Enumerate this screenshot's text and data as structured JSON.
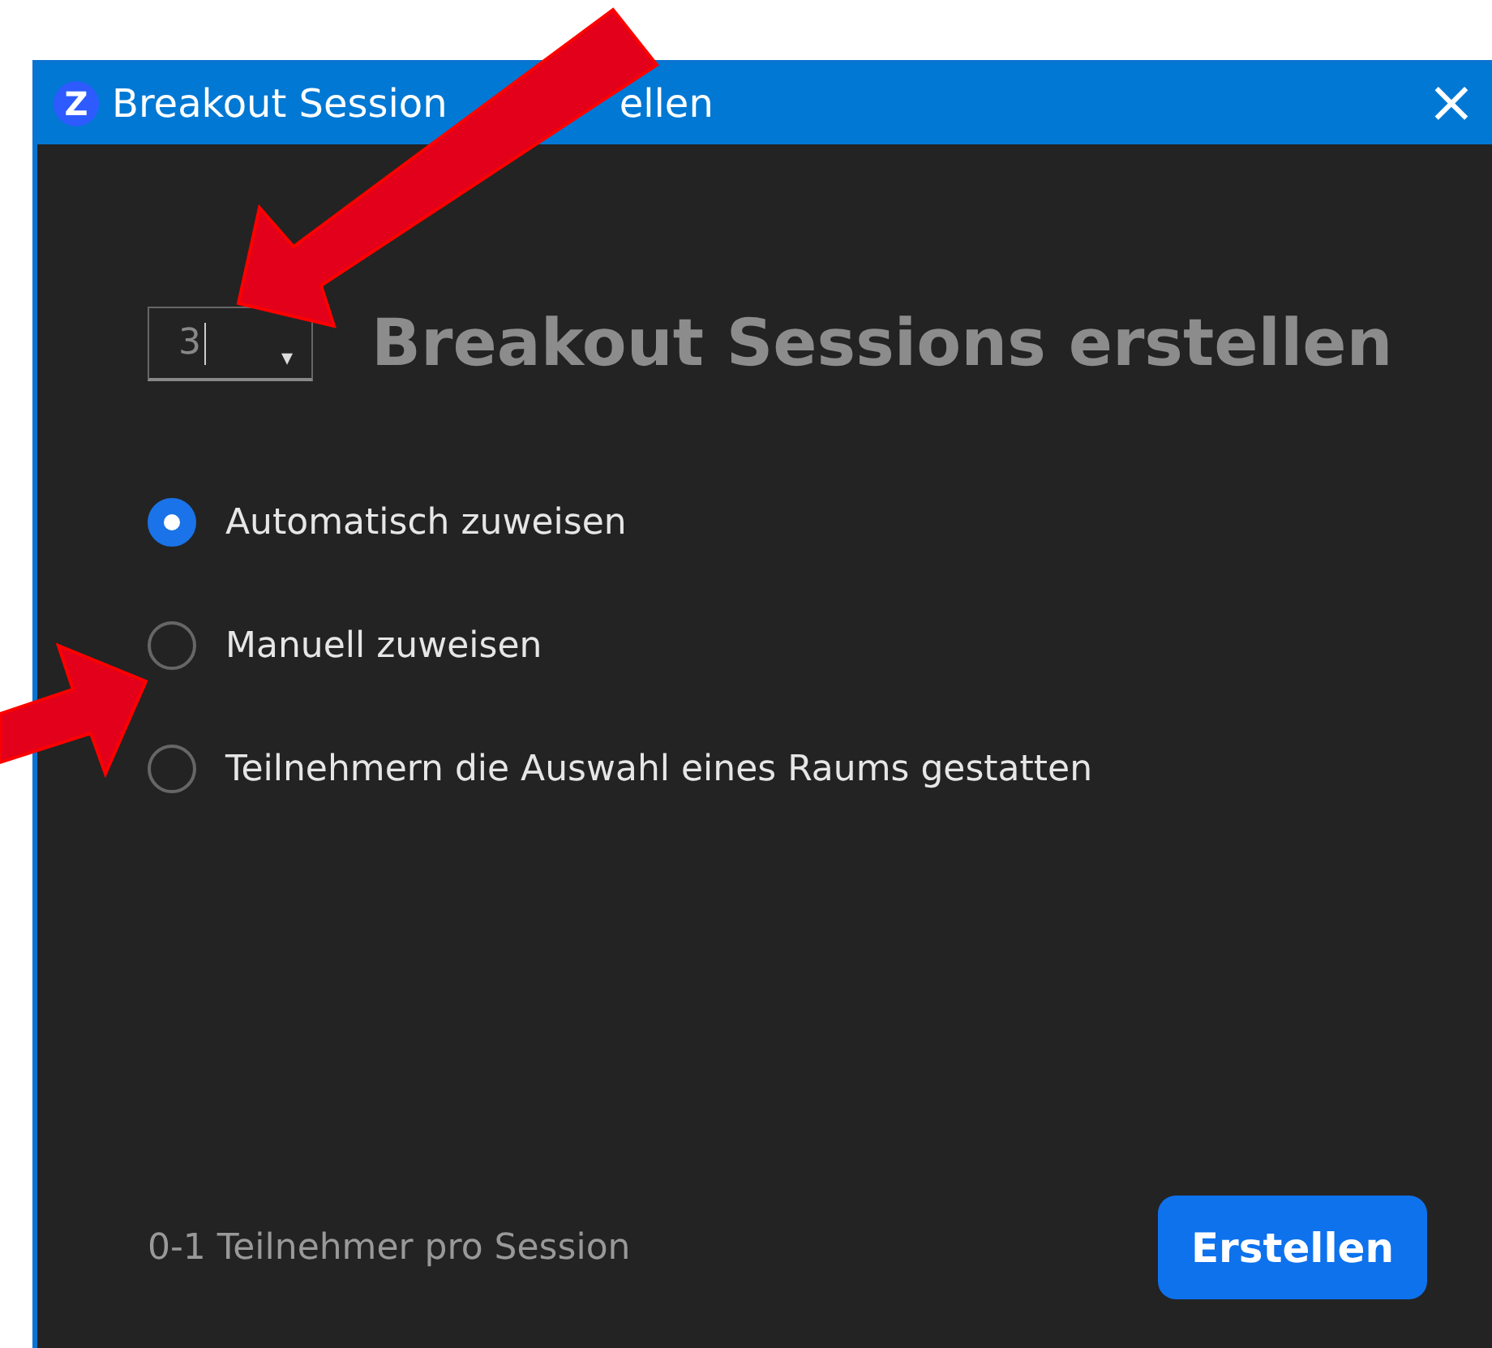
{
  "window": {
    "app_icon": "Z",
    "title_parts": [
      "Breakout Session",
      "ellen"
    ],
    "close": "×"
  },
  "session_count": {
    "value": "3",
    "down": "▾"
  },
  "heading": "Breakout Sessions erstellen",
  "options": [
    {
      "label": "Automatisch zuweisen",
      "selected": true
    },
    {
      "label": "Manuell zuweisen",
      "selected": false
    },
    {
      "label": "Teilnehmern die Auswahl eines Raums gestatten",
      "selected": false
    }
  ],
  "footer": {
    "info": "0-1 Teilnehmer pro Session",
    "button": "Erstellen"
  }
}
